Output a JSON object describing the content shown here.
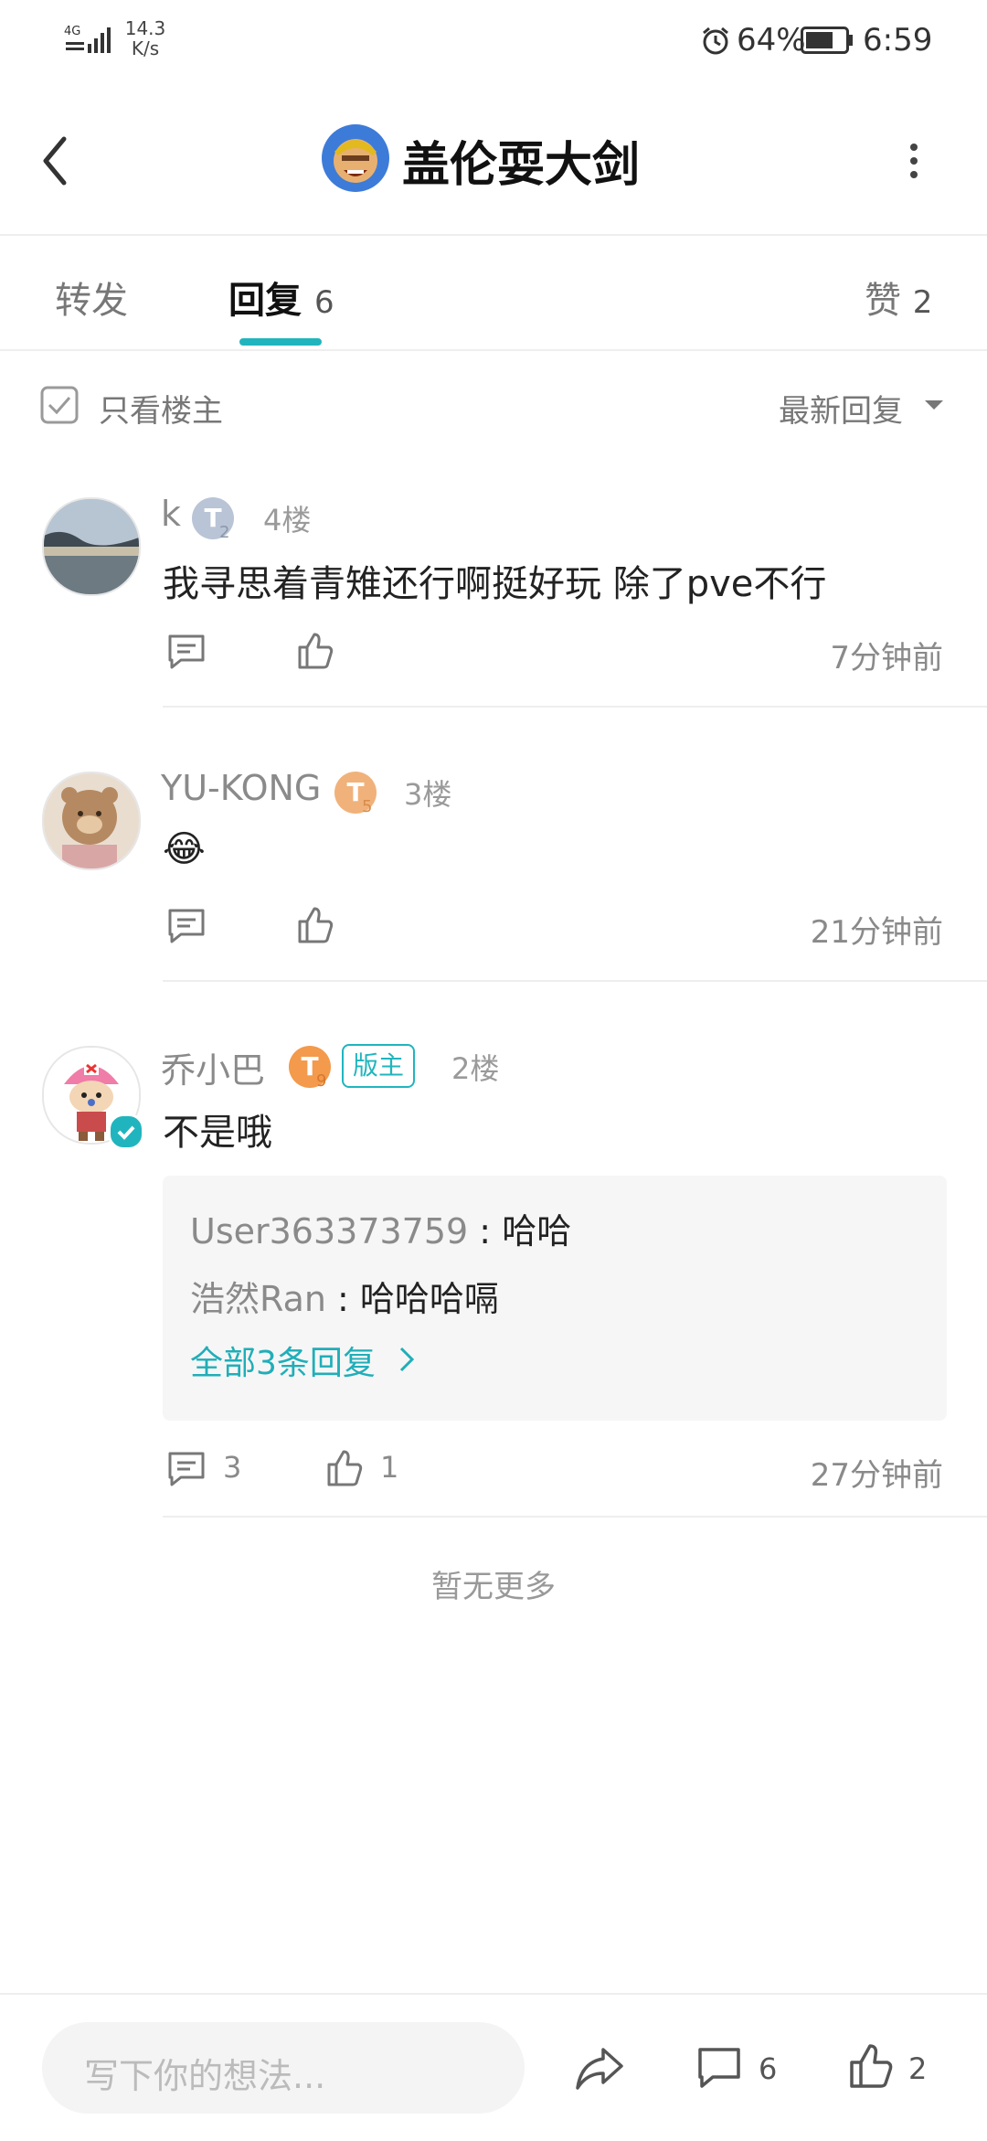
{
  "status_bar": {
    "network": "4G",
    "speed_value": "14.3",
    "speed_unit": "K/s",
    "battery": "64%",
    "time": "6:59",
    "icons": [
      "signal-icon",
      "alarm-icon",
      "battery-icon"
    ]
  },
  "header": {
    "title": "盖伦耍大剑",
    "icons": [
      "back-icon",
      "avatar-icon",
      "more-icon"
    ]
  },
  "tabs": [
    {
      "label": "转发",
      "count": ""
    },
    {
      "label": "回复",
      "count": "6",
      "active": true
    },
    {
      "label": "赞",
      "count": "2"
    }
  ],
  "filter": {
    "only_op_label": "只看楼主",
    "sort_label": "最新回复"
  },
  "comments": [
    {
      "username": "k",
      "badge": "T",
      "badge_level": "2",
      "floor": "4楼",
      "text": "我寻思着青雉还行啊挺好玩  除了pve不行",
      "time": "7分钟前",
      "reply_count": "",
      "like_count": ""
    },
    {
      "username": "YU-KONG",
      "badge": "T",
      "badge_level": "5",
      "floor": "3楼",
      "text": "😂",
      "time": "21分钟前",
      "reply_count": "",
      "like_count": ""
    },
    {
      "username": "乔小巴",
      "badge": "T",
      "badge_level": "9",
      "mod_tag": "版主",
      "floor": "2楼",
      "text": "不是哦",
      "time": "27分钟前",
      "reply_count": "3",
      "like_count": "1",
      "replies": [
        {
          "user": "User363373759",
          "sep": " : ",
          "text": "哈哈"
        },
        {
          "user": "浩然Ran",
          "sep": " : ",
          "text": "哈哈哈嗝"
        }
      ],
      "more_replies": "全部3条回复"
    }
  ],
  "footer_note": "暂无更多",
  "bottom_bar": {
    "placeholder": "写下你的想法...",
    "comment_count": "6",
    "like_count": "2"
  },
  "colors": {
    "accent": "#20b5be",
    "badge_silver": "#b9c4d6",
    "badge_bronze": "#f0b27a",
    "badge_orange": "#f39a4c"
  }
}
